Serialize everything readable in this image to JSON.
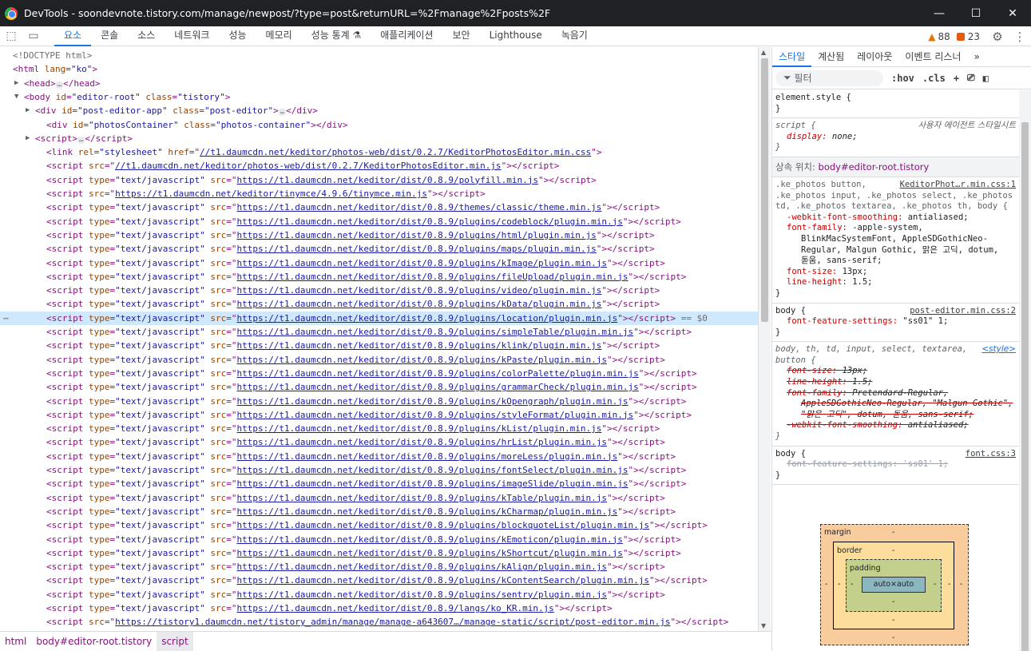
{
  "window": {
    "title": "DevTools - soondevnote.tistory.com/manage/newpost/?type=post&returnURL=%2Fmanage%2Fposts%2F",
    "controls": [
      "—",
      "☐",
      "✕"
    ]
  },
  "toolbar": {
    "tabs": [
      "요소",
      "콘솔",
      "소스",
      "네트워크",
      "성능",
      "메모리",
      "성능 통계 ⚗",
      "애플리케이션",
      "보안",
      "Lighthouse",
      "녹음기"
    ],
    "active_tab": "요소",
    "warnings": "88",
    "errors": "23"
  },
  "elements": {
    "lines": [
      {
        "t": "cmt",
        "text": "<!DOCTYPE html>"
      },
      {
        "t": "open",
        "indent": 0,
        "tag": "html",
        "attrs": [
          [
            "lang",
            "ko"
          ]
        ],
        "close": false
      },
      {
        "t": "collapsed",
        "indent": 1,
        "tag": "head"
      },
      {
        "t": "open",
        "indent": 1,
        "tri": "▼",
        "tag": "body",
        "attrs": [
          [
            "id",
            "editor-root"
          ],
          [
            "class",
            "tistory"
          ]
        ],
        "close": false
      },
      {
        "t": "collapsed-attrs",
        "indent": 2,
        "tag": "div",
        "attrs": [
          [
            "id",
            "post-editor-app"
          ],
          [
            "class",
            "post-editor"
          ]
        ]
      },
      {
        "t": "open",
        "indent": 3,
        "tag": "div",
        "attrs": [
          [
            "id",
            "photosContainer"
          ],
          [
            "class",
            "photos-container"
          ]
        ],
        "close": true
      },
      {
        "t": "collapsed",
        "indent": 2,
        "tag": "script"
      },
      {
        "t": "link",
        "indent": 3,
        "tag": "link",
        "pre": [
          [
            "rel",
            "stylesheet"
          ]
        ],
        "key": "href",
        "url": "//t1.daumcdn.net/keditor/photos-web/dist/0.2.7/KeditorPhotosEditor.min.css",
        "suffix": "",
        "close": false
      },
      {
        "t": "link",
        "indent": 3,
        "tag": "script",
        "pre": [],
        "key": "src",
        "url": "//t1.daumcdn.net/keditor/photos-web/dist/0.2.7/KeditorPhotosEditor.min.js",
        "suffix": "",
        "close": true
      },
      {
        "t": "link",
        "indent": 3,
        "tag": "script",
        "pre": [
          [
            "type",
            "text/javascript"
          ]
        ],
        "key": "src",
        "url": "https://t1.daumcdn.net/keditor/dist/0.8.9/polyfill.min.js",
        "suffix": "",
        "close": true
      },
      {
        "t": "link",
        "indent": 3,
        "tag": "script",
        "pre": [],
        "key": "src",
        "url": "https://t1.daumcdn.net/keditor/tinymce/4.9.6/tinymce.min.js",
        "suffix": "",
        "close": true
      },
      {
        "t": "link",
        "indent": 3,
        "tag": "script",
        "pre": [
          [
            "type",
            "text/javascript"
          ]
        ],
        "key": "src",
        "url": "https://t1.daumcdn.net/keditor/dist/0.8.9/themes/classic/theme.min.js",
        "suffix": "",
        "close": true
      },
      {
        "t": "link",
        "indent": 3,
        "tag": "script",
        "pre": [
          [
            "type",
            "text/javascript"
          ]
        ],
        "key": "src",
        "url": "https://t1.daumcdn.net/keditor/dist/0.8.9/plugins/codeblock/plugin.min.js",
        "suffix": "",
        "close": true
      },
      {
        "t": "link",
        "indent": 3,
        "tag": "script",
        "pre": [
          [
            "type",
            "text/javascript"
          ]
        ],
        "key": "src",
        "url": "https://t1.daumcdn.net/keditor/dist/0.8.9/plugins/html/plugin.min.js",
        "suffix": "",
        "close": true
      },
      {
        "t": "link",
        "indent": 3,
        "tag": "script",
        "pre": [
          [
            "type",
            "text/javascript"
          ]
        ],
        "key": "src",
        "url": "https://t1.daumcdn.net/keditor/dist/0.8.9/plugins/maps/plugin.min.js",
        "suffix": "",
        "close": true
      },
      {
        "t": "link",
        "indent": 3,
        "tag": "script",
        "pre": [
          [
            "type",
            "text/javascript"
          ]
        ],
        "key": "src",
        "url": "https://t1.daumcdn.net/keditor/dist/0.8.9/plugins/kImage/plugin.min.js",
        "suffix": "",
        "close": true
      },
      {
        "t": "link",
        "indent": 3,
        "tag": "script",
        "pre": [
          [
            "type",
            "text/javascript"
          ]
        ],
        "key": "src",
        "url": "https://t1.daumcdn.net/keditor/dist/0.8.9/plugins/fileUpload/plugin.min.js",
        "suffix": "",
        "close": true
      },
      {
        "t": "link",
        "indent": 3,
        "tag": "script",
        "pre": [
          [
            "type",
            "text/javascript"
          ]
        ],
        "key": "src",
        "url": "https://t1.daumcdn.net/keditor/dist/0.8.9/plugins/video/plugin.min.js",
        "suffix": "",
        "close": true
      },
      {
        "t": "link",
        "indent": 3,
        "tag": "script",
        "pre": [
          [
            "type",
            "text/javascript"
          ]
        ],
        "key": "src",
        "url": "https://t1.daumcdn.net/keditor/dist/0.8.9/plugins/kData/plugin.min.js",
        "suffix": "",
        "close": true
      },
      {
        "t": "link",
        "indent": 3,
        "tag": "script",
        "pre": [
          [
            "type",
            "text/javascript"
          ]
        ],
        "key": "src",
        "url": "https://t1.daumcdn.net/keditor/dist/0.8.9/plugins/location/plugin.min.js",
        "suffix": " == $0",
        "close": true,
        "selected": true
      },
      {
        "t": "link",
        "indent": 3,
        "tag": "script",
        "pre": [
          [
            "type",
            "text/javascript"
          ]
        ],
        "key": "src",
        "url": "https://t1.daumcdn.net/keditor/dist/0.8.9/plugins/simpleTable/plugin.min.js",
        "suffix": "",
        "close": true
      },
      {
        "t": "link",
        "indent": 3,
        "tag": "script",
        "pre": [
          [
            "type",
            "text/javascript"
          ]
        ],
        "key": "src",
        "url": "https://t1.daumcdn.net/keditor/dist/0.8.9/plugins/klink/plugin.min.js",
        "suffix": "",
        "close": true
      },
      {
        "t": "link",
        "indent": 3,
        "tag": "script",
        "pre": [
          [
            "type",
            "text/javascript"
          ]
        ],
        "key": "src",
        "url": "https://t1.daumcdn.net/keditor/dist/0.8.9/plugins/kPaste/plugin.min.js",
        "suffix": "",
        "close": true
      },
      {
        "t": "link",
        "indent": 3,
        "tag": "script",
        "pre": [
          [
            "type",
            "text/javascript"
          ]
        ],
        "key": "src",
        "url": "https://t1.daumcdn.net/keditor/dist/0.8.9/plugins/colorPalette/plugin.min.js",
        "suffix": "",
        "close": true
      },
      {
        "t": "link",
        "indent": 3,
        "tag": "script",
        "pre": [
          [
            "type",
            "text/javascript"
          ]
        ],
        "key": "src",
        "url": "https://t1.daumcdn.net/keditor/dist/0.8.9/plugins/grammarCheck/plugin.min.js",
        "suffix": "",
        "close": true
      },
      {
        "t": "link",
        "indent": 3,
        "tag": "script",
        "pre": [
          [
            "type",
            "text/javascript"
          ]
        ],
        "key": "src",
        "url": "https://t1.daumcdn.net/keditor/dist/0.8.9/plugins/kOpengraph/plugin.min.js",
        "suffix": "",
        "close": true
      },
      {
        "t": "link",
        "indent": 3,
        "tag": "script",
        "pre": [
          [
            "type",
            "text/javascript"
          ]
        ],
        "key": "src",
        "url": "https://t1.daumcdn.net/keditor/dist/0.8.9/plugins/styleFormat/plugin.min.js",
        "suffix": "",
        "close": true
      },
      {
        "t": "link",
        "indent": 3,
        "tag": "script",
        "pre": [
          [
            "type",
            "text/javascript"
          ]
        ],
        "key": "src",
        "url": "https://t1.daumcdn.net/keditor/dist/0.8.9/plugins/kList/plugin.min.js",
        "suffix": "",
        "close": true
      },
      {
        "t": "link",
        "indent": 3,
        "tag": "script",
        "pre": [
          [
            "type",
            "text/javascript"
          ]
        ],
        "key": "src",
        "url": "https://t1.daumcdn.net/keditor/dist/0.8.9/plugins/hrList/plugin.min.js",
        "suffix": "",
        "close": true
      },
      {
        "t": "link",
        "indent": 3,
        "tag": "script",
        "pre": [
          [
            "type",
            "text/javascript"
          ]
        ],
        "key": "src",
        "url": "https://t1.daumcdn.net/keditor/dist/0.8.9/plugins/moreLess/plugin.min.js",
        "suffix": "",
        "close": true
      },
      {
        "t": "link",
        "indent": 3,
        "tag": "script",
        "pre": [
          [
            "type",
            "text/javascript"
          ]
        ],
        "key": "src",
        "url": "https://t1.daumcdn.net/keditor/dist/0.8.9/plugins/fontSelect/plugin.min.js",
        "suffix": "",
        "close": true
      },
      {
        "t": "link",
        "indent": 3,
        "tag": "script",
        "pre": [
          [
            "type",
            "text/javascript"
          ]
        ],
        "key": "src",
        "url": "https://t1.daumcdn.net/keditor/dist/0.8.9/plugins/imageSlide/plugin.min.js",
        "suffix": "",
        "close": true
      },
      {
        "t": "link",
        "indent": 3,
        "tag": "script",
        "pre": [
          [
            "type",
            "text/javascript"
          ]
        ],
        "key": "src",
        "url": "https://t1.daumcdn.net/keditor/dist/0.8.9/plugins/kTable/plugin.min.js",
        "suffix": "",
        "close": true
      },
      {
        "t": "link",
        "indent": 3,
        "tag": "script",
        "pre": [
          [
            "type",
            "text/javascript"
          ]
        ],
        "key": "src",
        "url": "https://t1.daumcdn.net/keditor/dist/0.8.9/plugins/kCharmap/plugin.min.js",
        "suffix": "",
        "close": true
      },
      {
        "t": "link",
        "indent": 3,
        "tag": "script",
        "pre": [
          [
            "type",
            "text/javascript"
          ]
        ],
        "key": "src",
        "url": "https://t1.daumcdn.net/keditor/dist/0.8.9/plugins/blockquoteList/plugin.min.js",
        "suffix": "",
        "close": true
      },
      {
        "t": "link",
        "indent": 3,
        "tag": "script",
        "pre": [
          [
            "type",
            "text/javascript"
          ]
        ],
        "key": "src",
        "url": "https://t1.daumcdn.net/keditor/dist/0.8.9/plugins/kEmoticon/plugin.min.js",
        "suffix": "",
        "close": true
      },
      {
        "t": "link",
        "indent": 3,
        "tag": "script",
        "pre": [
          [
            "type",
            "text/javascript"
          ]
        ],
        "key": "src",
        "url": "https://t1.daumcdn.net/keditor/dist/0.8.9/plugins/kShortcut/plugin.min.js",
        "suffix": "",
        "close": true
      },
      {
        "t": "link",
        "indent": 3,
        "tag": "script",
        "pre": [
          [
            "type",
            "text/javascript"
          ]
        ],
        "key": "src",
        "url": "https://t1.daumcdn.net/keditor/dist/0.8.9/plugins/kAlign/plugin.min.js",
        "suffix": "",
        "close": true
      },
      {
        "t": "link",
        "indent": 3,
        "tag": "script",
        "pre": [
          [
            "type",
            "text/javascript"
          ]
        ],
        "key": "src",
        "url": "https://t1.daumcdn.net/keditor/dist/0.8.9/plugins/kContentSearch/plugin.min.js",
        "suffix": "",
        "close": true
      },
      {
        "t": "link",
        "indent": 3,
        "tag": "script",
        "pre": [
          [
            "type",
            "text/javascript"
          ]
        ],
        "key": "src",
        "url": "https://t1.daumcdn.net/keditor/dist/0.8.9/plugins/sentry/plugin.min.js",
        "suffix": "",
        "close": true
      },
      {
        "t": "link",
        "indent": 3,
        "tag": "script",
        "pre": [
          [
            "type",
            "text/javascript"
          ]
        ],
        "key": "src",
        "url": "https://t1.daumcdn.net/keditor/dist/0.8.9/langs/ko_KR.min.js",
        "suffix": "",
        "close": true
      },
      {
        "t": "link",
        "indent": 3,
        "tag": "script",
        "pre": [],
        "key": "src",
        "url": "https://tistory1.daumcdn.net/tistory_admin/manage/manage-a643607…/manage-static/script/post-editor.min.js",
        "suffix": "",
        "close": true
      }
    ]
  },
  "breadcrumb": [
    "html",
    "body#editor-root.tistory",
    "script"
  ],
  "styles": {
    "tabs": [
      "스타일",
      "계산됨",
      "레이아웃",
      "이벤트 리스너",
      "»"
    ],
    "active_tab": "스타일",
    "filter_placeholder": "필터",
    "hov": ":hov",
    "cls": ".cls",
    "element_style": "element.style {",
    "close_brace": "}",
    "ua_rule": {
      "selector": "script {",
      "source": "사용자 에이전트 스타일시트",
      "prop": "display",
      "value": "none;"
    },
    "inherited_label": "상속 위치: ",
    "inherited_ref": "body#editor-root.tistory",
    "rule1": {
      "selector_lines": [
        ".ke_photos button,",
        ".ke_photos input, .ke_photos select, .ke_photos",
        "td, .ke_photos textarea, .ke_photos th, body {"
      ],
      "source": "KeditorPhot…r.min.css:1",
      "props": [
        {
          "p": "-webkit-font-smoothing",
          "v": "antialiased;"
        },
        {
          "p": "font-family",
          "v": "-apple-system,"
        },
        {
          "p": "",
          "v": "BlinkMacSystemFont, AppleSDGothicNeo-"
        },
        {
          "p": "",
          "v": "Regular, Malgun Gothic, 맑은 고딕, dotum,"
        },
        {
          "p": "",
          "v": "돋움, sans-serif;"
        },
        {
          "p": "font-size",
          "v": "13px;"
        },
        {
          "p": "line-height",
          "v": "1.5;"
        }
      ]
    },
    "rule2": {
      "selector": "body {",
      "source": "post-editor.min.css:2",
      "prop": "font-feature-settings",
      "value": "\"ss01\" 1;"
    },
    "rule3": {
      "selector_lines": [
        "body, th, td, input, select, textarea,",
        "button {"
      ],
      "source": "<style>",
      "props": [
        {
          "p": "font-size",
          "v": "13px;"
        },
        {
          "p": "line-height",
          "v": "1.5;"
        },
        {
          "p": "font-family",
          "v": "Pretendard-Regular,"
        },
        {
          "p": "",
          "v": "AppleSDGothicNeo-Regular, \"Malgun Gothic\","
        },
        {
          "p": "",
          "v": "\"맑은 고딕\", dotum, 돋움, sans-serif;"
        },
        {
          "p": "-webkit-font-smoothing",
          "v": "antialiased;"
        }
      ]
    },
    "rule4": {
      "selector": "body {",
      "source": "font.css:3",
      "prop": "font-feature-settings",
      "value": "'ss01' 1;"
    }
  },
  "box_model": {
    "margin": "margin",
    "border": "border",
    "padding": "padding",
    "content": "auto×auto",
    "dash": "-"
  }
}
